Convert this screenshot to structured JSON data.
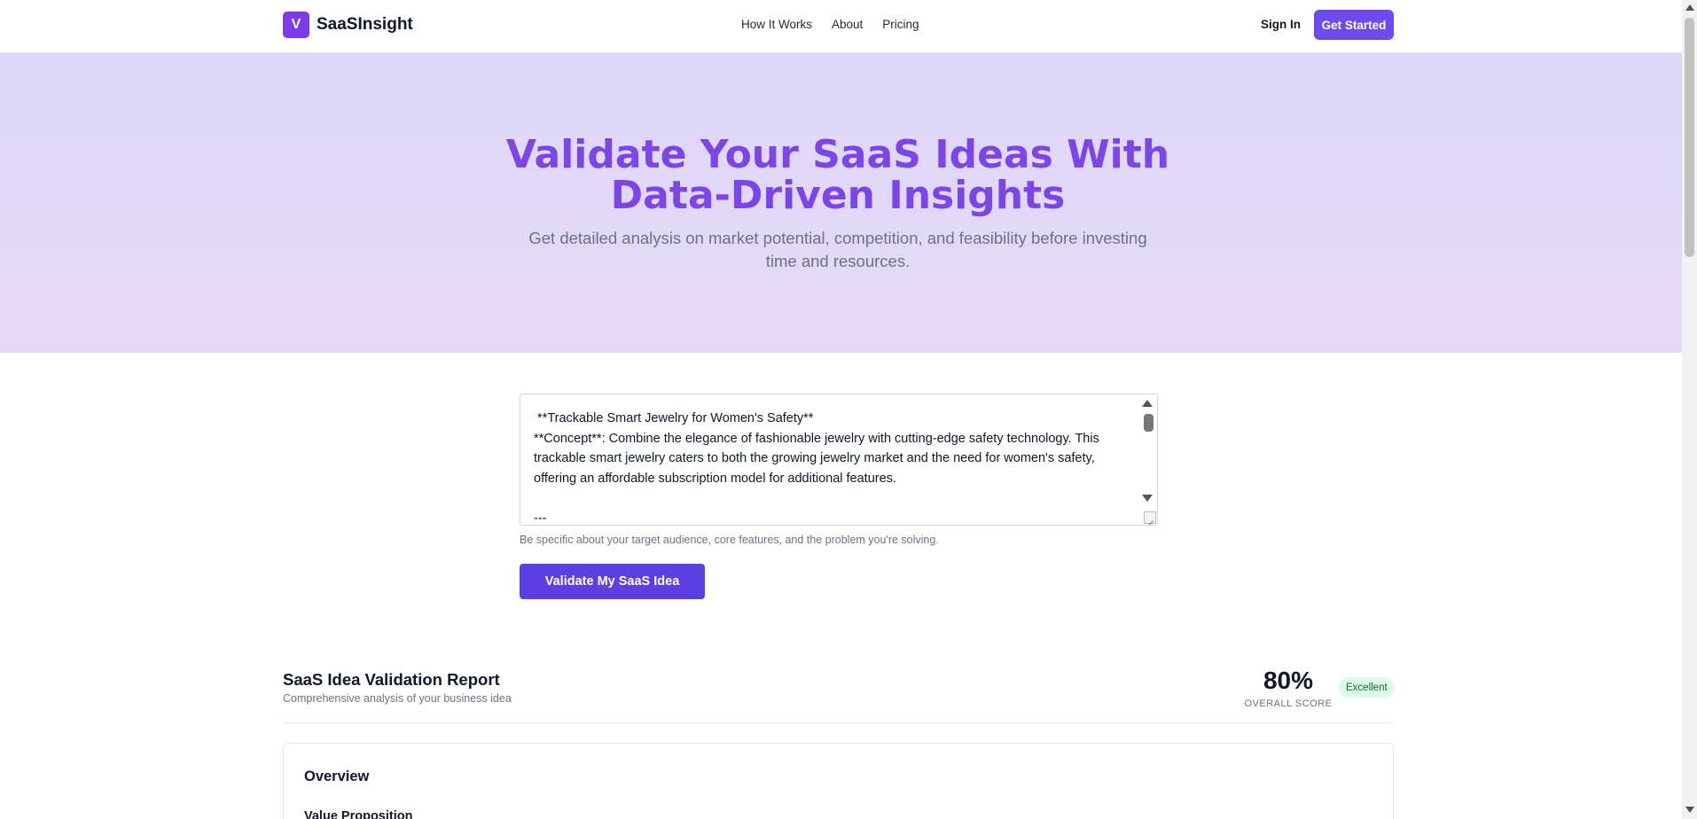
{
  "nav": {
    "logo_letter": "V",
    "brand": "SaaSInsight",
    "links": [
      "How It Works",
      "About",
      "Pricing"
    ],
    "sign_in": "Sign In",
    "get_started": "Get Started"
  },
  "hero": {
    "title_line1": "Validate Your SaaS Ideas With",
    "title_line2": "Data-Driven Insights",
    "subtitle": "Get detailed analysis on market potential, competition, and feasibility before investing time and resources."
  },
  "form": {
    "idea_value": " **Trackable Smart Jewelry for Women's Safety**\n**Concept**: Combine the elegance of fashionable jewelry with cutting-edge safety technology. This trackable smart jewelry caters to both the growing jewelry market and the need for women's safety, offering an affordable subscription model for additional features.\n\n---",
    "hint": "Be specific about your target audience, core features, and the problem you're solving.",
    "submit_label": "Validate My SaaS Idea"
  },
  "report": {
    "title": "SaaS Idea Validation Report",
    "subtitle": "Comprehensive analysis of your business idea",
    "score_value": "80%",
    "score_label": "OVERALL SCORE",
    "score_badge": "Excellent",
    "overview_title": "Overview",
    "value_proposition_title": "Value Proposition"
  },
  "colors": {
    "accent": "#6d4aed",
    "hero_title": "#7c45e8",
    "badge_bg": "#dcfce7",
    "badge_text": "#166534"
  }
}
